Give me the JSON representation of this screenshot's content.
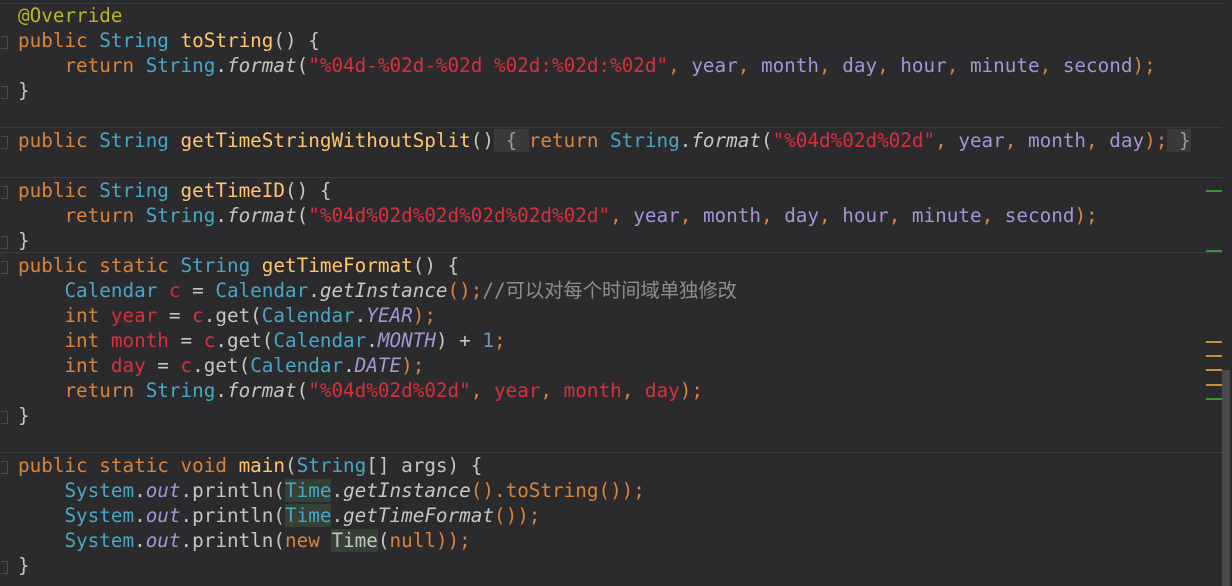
{
  "colors": {
    "background": "#2b2b2d",
    "keyword": "#d9843b",
    "type": "#48a7c4",
    "method": "#ffc66d",
    "string": "#d8303a",
    "field": "#a694d4",
    "comment": "#8e8e8e",
    "number": "#6897bb",
    "text": "#c5c5c5"
  },
  "code": {
    "l1": {
      "annotation": "@Override"
    },
    "l2": {
      "public": "public",
      "type": "String",
      "method": "toString",
      "rest": "() {"
    },
    "l3": {
      "indent": "    ",
      "ret": "return",
      "sp": " ",
      "cls": "String",
      "dot": ".",
      "call": "format",
      "open": "(",
      "str": "\"%04d-%02d-%02d %02d:%02d:%02d\"",
      "c1": ", ",
      "a1": "year",
      "c2": ", ",
      "a2": "month",
      "c3": ", ",
      "a3": "day",
      "c4": ", ",
      "a4": "hour",
      "c5": ", ",
      "a5": "minute",
      "c6": ", ",
      "a6": "second",
      "end": ");"
    },
    "l4": {
      "brace": "}"
    },
    "l5": {
      "public": "public",
      "type": "String",
      "method": "getTimeStringWithoutSplit",
      "paren": "()",
      "fold_open": " { ",
      "ret": "return",
      "cls": "String",
      "dot": ".",
      "call": "format",
      "open": "(",
      "str": "\"%04d%02d%02d\"",
      "c1": ", ",
      "a1": "year",
      "c2": ", ",
      "a2": "month",
      "c3": ", ",
      "a3": "day",
      "end": ");",
      "fold_close": " }"
    },
    "l6": {
      "public": "public",
      "type": "String",
      "method": "getTimeID",
      "rest": "() {"
    },
    "l7": {
      "indent": "    ",
      "ret": "return",
      "sp": " ",
      "cls": "String",
      "dot": ".",
      "call": "format",
      "open": "(",
      "str": "\"%04d%02d%02d%02d%02d%02d\"",
      "c1": ", ",
      "a1": "year",
      "c2": ", ",
      "a2": "month",
      "c3": ", ",
      "a3": "day",
      "c4": ", ",
      "a4": "hour",
      "c5": ", ",
      "a5": "minute",
      "c6": ", ",
      "a6": "second",
      "end": ");"
    },
    "l8": {
      "brace": "}"
    },
    "l9": {
      "public": "public",
      "static": "static",
      "type": "String",
      "method": "getTimeFormat",
      "rest": "() {"
    },
    "l10": {
      "indent": "    ",
      "cls": "Calendar",
      "var": "c",
      "eq": " = ",
      "cls2": "Calendar",
      "dot": ".",
      "call": "getInstance",
      "end": "();",
      "comment": "//可以对每个时间域单独修改"
    },
    "l11": {
      "indent": "    ",
      "int": "int",
      "var": "year",
      "eq": " = ",
      "c": "c",
      "get": ".get(",
      "cls": "Calendar",
      "dot": ".",
      "const": "YEAR",
      "end": ");"
    },
    "l12": {
      "indent": "    ",
      "int": "int",
      "var": "month",
      "eq": " = ",
      "c": "c",
      "get": ".get(",
      "cls": "Calendar",
      "dot": ".",
      "const": "MONTH",
      "mid": ") + ",
      "num": "1",
      "end": ";"
    },
    "l13": {
      "indent": "    ",
      "int": "int",
      "var": "day",
      "eq": " = ",
      "c": "c",
      "get": ".get(",
      "cls": "Calendar",
      "dot": ".",
      "const": "DATE",
      "end": ");"
    },
    "l14": {
      "indent": "    ",
      "ret": "return",
      "sp": " ",
      "cls": "String",
      "dot": ".",
      "call": "format",
      "open": "(",
      "str": "\"%04d%02d%02d\"",
      "c1": ", ",
      "a1": "year",
      "c2": ", ",
      "a2": "month",
      "c3": ", ",
      "a3": "day",
      "end": ");"
    },
    "l15": {
      "brace": "}"
    },
    "l16": {
      "public": "public",
      "static": "static",
      "void": "void",
      "method": "main",
      "open": "(",
      "type": "String",
      "rest": "[] args) {"
    },
    "l17": {
      "indent": "    ",
      "sys": "System",
      "dot": ".",
      "out": "out",
      "println": ".println(",
      "time": "Time",
      "dot2": ".",
      "call": "getInstance",
      "end": "().toString());"
    },
    "l18": {
      "indent": "    ",
      "sys": "System",
      "dot": ".",
      "out": "out",
      "println": ".println(",
      "time": "Time",
      "dot2": ".",
      "call": "getTimeFormat",
      "end": "());"
    },
    "l19": {
      "indent": "    ",
      "sys": "System",
      "dot": ".",
      "out": "out",
      "println": ".println(",
      "new": "new",
      "sp": " ",
      "time": "Time",
      "open": "(",
      "null": "null",
      "end": "));"
    },
    "l20": {
      "brace": "}"
    }
  }
}
